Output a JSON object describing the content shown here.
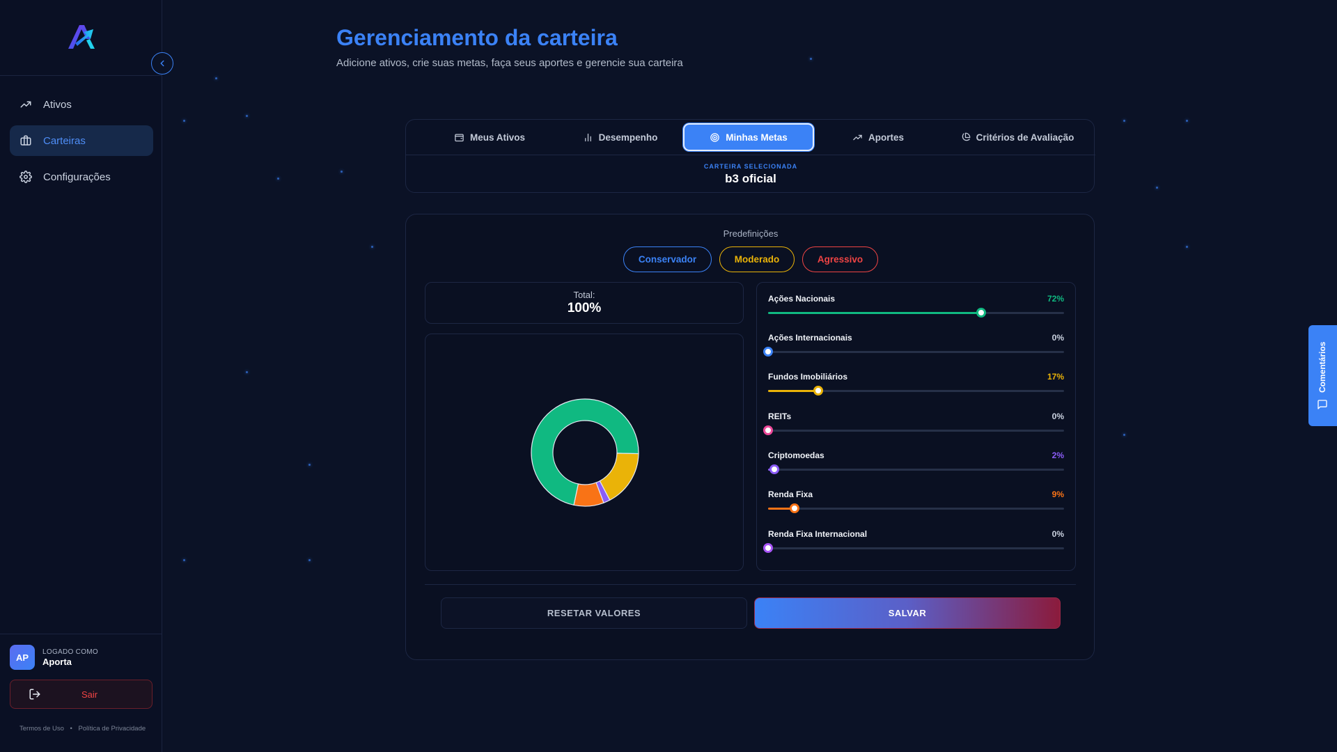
{
  "sidebar": {
    "items": [
      {
        "label": "Ativos",
        "icon": "trending-up-icon",
        "active": false
      },
      {
        "label": "Carteiras",
        "icon": "briefcase-icon",
        "active": true
      },
      {
        "label": "Configurações",
        "icon": "gear-icon",
        "active": false
      }
    ],
    "user": {
      "initials": "AP",
      "caption": "LOGADO COMO",
      "name": "Aporta"
    },
    "logout_label": "Sair",
    "footer": {
      "terms": "Termos de Uso",
      "separator": "•",
      "privacy": "Política de Privacidade"
    }
  },
  "header": {
    "title": "Gerenciamento da carteira",
    "subtitle": "Adicione ativos, crie suas metas, faça seus aportes e gerencie sua carteira"
  },
  "tabs": [
    {
      "label": "Meus Ativos",
      "icon": "wallet-icon",
      "active": false
    },
    {
      "label": "Desempenho",
      "icon": "bar-chart-icon",
      "active": false
    },
    {
      "label": "Minhas Metas",
      "icon": "target-icon",
      "active": true
    },
    {
      "label": "Aportes",
      "icon": "trending-up-icon",
      "active": false
    },
    {
      "label": "Critérios de Avaliação",
      "icon": "pie-chart-icon",
      "active": false
    }
  ],
  "selected_portfolio": {
    "caption": "CARTEIRA SELECIONADA",
    "name": "b3 oficial"
  },
  "goals": {
    "presets_label": "Predefinições",
    "presets": [
      "Conservador",
      "Moderado",
      "Agressivo"
    ],
    "total_label": "Total:",
    "total_value": "100%",
    "allocations": [
      {
        "name": "Ações Nacionais",
        "value": 72,
        "display": "72%",
        "color": "#10b981"
      },
      {
        "name": "Ações Internacionais",
        "value": 0,
        "display": "0%",
        "color": "#3b82f6"
      },
      {
        "name": "Fundos Imobiliários",
        "value": 17,
        "display": "17%",
        "color": "#eab308"
      },
      {
        "name": "REITs",
        "value": 0,
        "display": "0%",
        "color": "#ec4899"
      },
      {
        "name": "Criptomoedas",
        "value": 2,
        "display": "2%",
        "color": "#8b5cf6"
      },
      {
        "name": "Renda Fixa",
        "value": 9,
        "display": "9%",
        "color": "#f97316"
      },
      {
        "name": "Renda Fixa Internacional",
        "value": 0,
        "display": "0%",
        "color": "#a855f7"
      }
    ],
    "reset_label": "RESETAR VALORES",
    "save_label": "SALVAR"
  },
  "chart_data": {
    "type": "pie",
    "categories": [
      "Ações Nacionais",
      "Ações Internacionais",
      "Fundos Imobiliários",
      "REITs",
      "Criptomoedas",
      "Renda Fixa",
      "Renda Fixa Internacional"
    ],
    "values": [
      72,
      0,
      17,
      0,
      2,
      9,
      0
    ],
    "colors": [
      "#10b981",
      "#3b82f6",
      "#eab308",
      "#ec4899",
      "#8b5cf6",
      "#f97316",
      "#a855f7"
    ],
    "style": "donut"
  },
  "feedback_label": "Comentários"
}
